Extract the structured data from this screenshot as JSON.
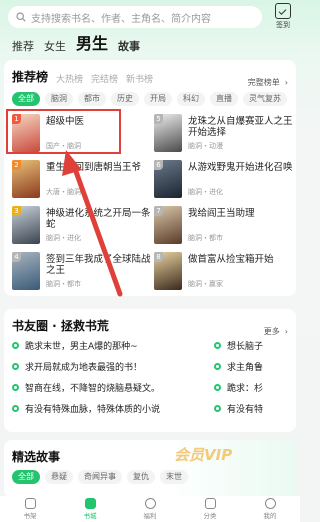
{
  "search": {
    "placeholder": "支持搜索书名、作者、主角名、简介内容"
  },
  "signin": {
    "label": "签到"
  },
  "top_tabs": [
    {
      "label": "推荐"
    },
    {
      "label": "女生"
    },
    {
      "label": "男生",
      "active": true
    },
    {
      "label": "故事"
    }
  ],
  "ranking": {
    "title": "推荐榜",
    "sub_tabs": [
      "大热榜",
      "完结榜",
      "新书榜"
    ],
    "more": "完整榜单",
    "chips": [
      "全部",
      "脑洞",
      "都市",
      "历史",
      "开局",
      "科幻",
      "直播",
      "灵气复苏"
    ],
    "books": [
      {
        "rank": "1",
        "title": "超级中医",
        "meta": "国产・脑洞",
        "badge_color": "#f15a3a",
        "cover": [
          "#f6d8c4",
          "#c94a3c"
        ]
      },
      {
        "rank": "2",
        "title": "重生之回到唐朝当王爷",
        "meta": "大唐・脑洞",
        "badge_color": "#f08a2a",
        "cover": [
          "#e9c27a",
          "#8a3a1c"
        ]
      },
      {
        "rank": "3",
        "title": "神级进化系统之开局一条蛇",
        "meta": "脑洞・进化",
        "badge_color": "#e8b11a",
        "cover": [
          "#c9d2d9",
          "#3a4450"
        ]
      },
      {
        "rank": "4",
        "title": "签到三年我成了全球陆战之王",
        "meta": "脑洞・都市",
        "badge_color": "#b6b6b6",
        "cover": [
          "#a8b5c0",
          "#3a5a78"
        ]
      },
      {
        "rank": "5",
        "title": "龙珠之从自爆赛亚人之王开始选择",
        "meta": "脑洞・动漫",
        "badge_color": "#b6b6b6",
        "cover": [
          "#eeeeee",
          "#4a4a4a"
        ]
      },
      {
        "rank": "6",
        "title": "从游戏野鬼开始进化召唤",
        "meta": "脑洞・进化",
        "badge_color": "#b6b6b6",
        "cover": [
          "#6b7a8a",
          "#1c2430"
        ]
      },
      {
        "rank": "7",
        "title": "我给阎王当助理",
        "meta": "脑洞・都市",
        "badge_color": "#b6b6b6",
        "cover": [
          "#d8c8a8",
          "#5a3a2a"
        ]
      },
      {
        "rank": "8",
        "title": "做首富从捡宝箱开始",
        "meta": "脑洞・赢家",
        "badge_color": "#b6b6b6",
        "cover": [
          "#e8d2a0",
          "#3b2a1c"
        ]
      }
    ]
  },
  "friends": {
    "title": "书友圈 · 拯救书荒",
    "more": "更多",
    "questions_left": [
      "跪求末世，男主A爆的那种~",
      "求开局就成为地表最强的书！",
      "智商在线，不降智的烧脑悬疑文。",
      "有没有特殊血脉，特殊体质的小说"
    ],
    "questions_right": [
      "想长脑子",
      "求主角鲁",
      "跪求：杉",
      "有没有特"
    ]
  },
  "featured": {
    "title": "精选故事",
    "chips": [
      "全部",
      "悬疑",
      "奇闻异事",
      "复仇",
      "末世"
    ],
    "vip_text": "会员VIP"
  },
  "bottom_nav": [
    {
      "label": "书架"
    },
    {
      "label": "书城",
      "active": true
    },
    {
      "label": "福利"
    },
    {
      "label": "分类"
    },
    {
      "label": "我的"
    }
  ],
  "colors": {
    "accent": "#22c46e",
    "highlight": "#e0403a"
  }
}
